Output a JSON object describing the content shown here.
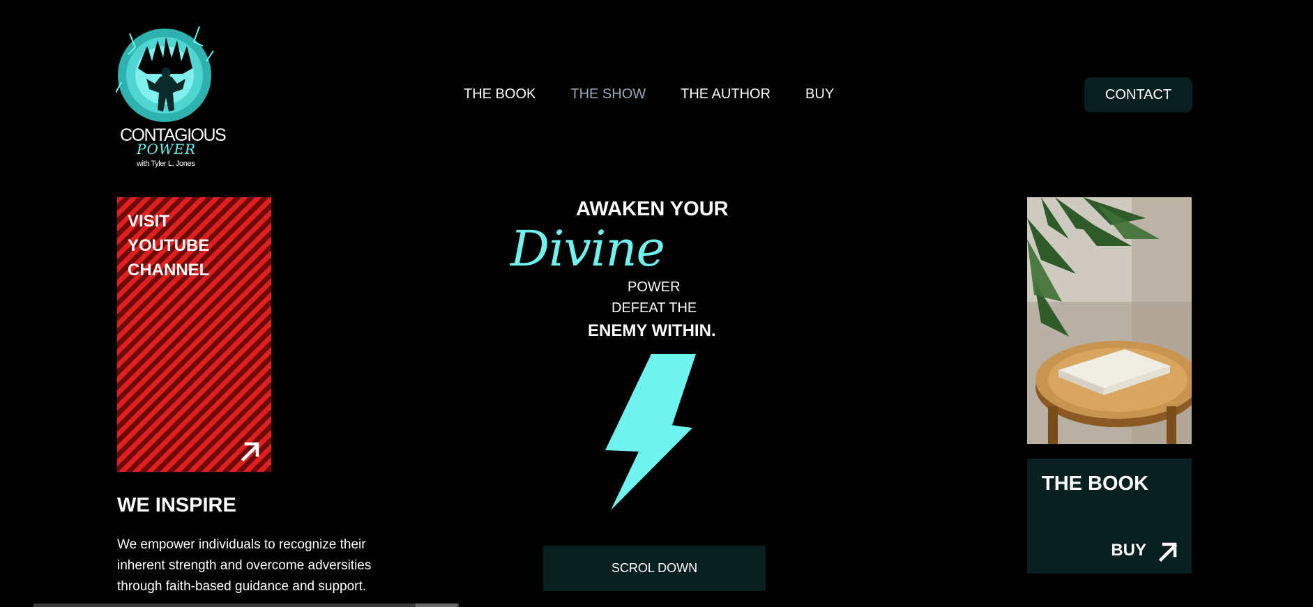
{
  "logo": {
    "title": "CONTAGIOUS",
    "subtitle": "POWER",
    "with": "with Tyler L. Jones"
  },
  "nav": {
    "items": [
      {
        "label": "THE BOOK",
        "active": false
      },
      {
        "label": "THE SHOW",
        "active": true
      },
      {
        "label": "THE AUTHOR",
        "active": false
      },
      {
        "label": "BUY",
        "active": false
      }
    ],
    "contact_label": "CONTACT"
  },
  "youtube_card": {
    "label": "VISIT\nYOUTUBE\nCHANNEL",
    "icon": "arrow-up-right-icon"
  },
  "inspire": {
    "title": "WE INSPIRE",
    "text": "We empower individuals to recognize their inherent strength and overcome adversities through faith-based guidance and support."
  },
  "hero": {
    "line1": "AWAKEN YOUR",
    "divine": "Divine",
    "power": "POWER",
    "defeat": "DEFEAT THE",
    "enemy": "ENEMY WITHIN.",
    "icon": "lightning-bolt-icon"
  },
  "scroll_button": {
    "label": "SCROL DOWN"
  },
  "book_card": {
    "title": "THE BOOK",
    "buy_label": "BUY",
    "icon": "arrow-up-right-icon"
  },
  "colors": {
    "accent": "#6ff3ee",
    "dark_panel": "#0a1f1f",
    "nav_active": "#9aa9b8",
    "youtube_red": "#e01f1f"
  }
}
